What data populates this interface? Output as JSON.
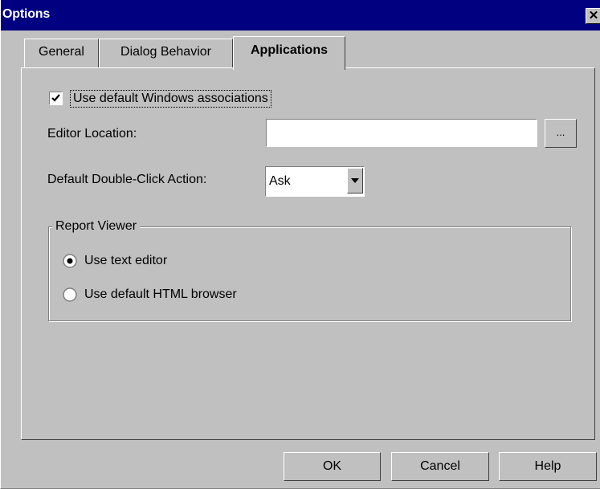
{
  "window": {
    "title": "Options",
    "close_glyph": "✕"
  },
  "tabs": [
    {
      "label": "General",
      "active": false
    },
    {
      "label": "Dialog Behavior",
      "active": false
    },
    {
      "label": "Applications",
      "active": true
    }
  ],
  "applications": {
    "use_default_assoc": {
      "label": "Use default Windows associations",
      "checked": true
    },
    "editor_location": {
      "label": "Editor Location:",
      "value": "",
      "browse_label": "..."
    },
    "double_click": {
      "label": "Default Double-Click Action:",
      "selected": "Ask"
    },
    "report_viewer": {
      "title": "Report Viewer",
      "options": [
        {
          "label": "Use text editor",
          "selected": true
        },
        {
          "label": "Use default HTML browser",
          "selected": false
        }
      ]
    }
  },
  "buttons": {
    "ok": "OK",
    "cancel": "Cancel",
    "help": "Help"
  }
}
